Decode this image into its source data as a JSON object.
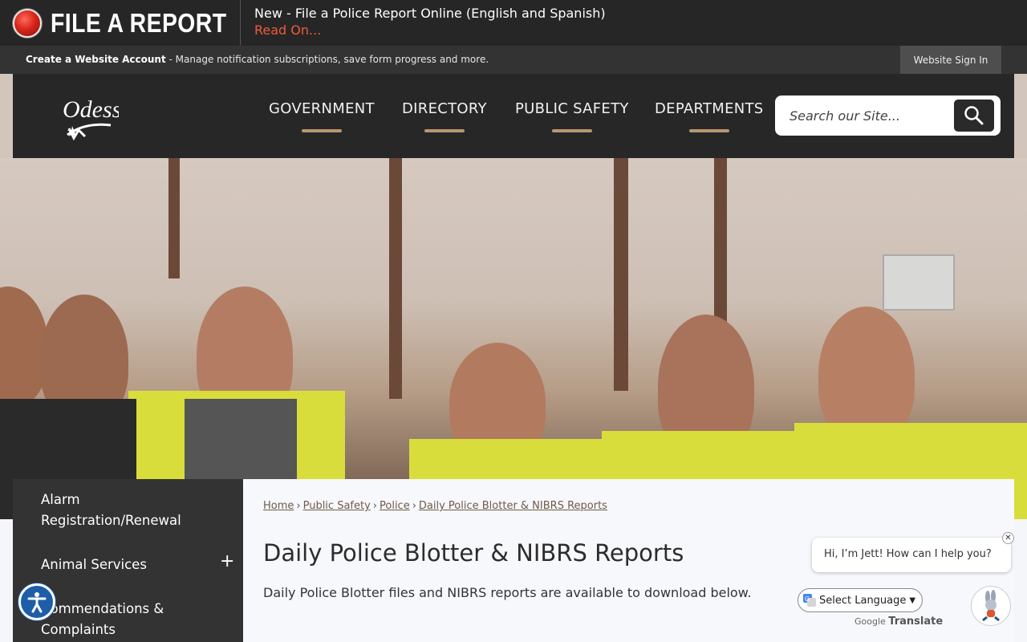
{
  "alert": {
    "label": "FILE A REPORT",
    "headline": "New - File a Police Report Online (English and Spanish)",
    "link": "Read On..."
  },
  "account": {
    "create_label": "Create a Website Account",
    "create_desc": " - Manage notification subscriptions, save form progress and more.",
    "signin_label": "Website Sign In"
  },
  "header": {
    "logo_text": "Odessa",
    "nav": [
      "GOVERNMENT",
      "DIRECTORY",
      "PUBLIC SAFETY",
      "DEPARTMENTS"
    ],
    "search_placeholder": "Search our Site..."
  },
  "sidebar": {
    "items": [
      {
        "label": "Alarm\nRegistration/Renewal"
      },
      {
        "label": "Animal Services"
      },
      {
        "label": "Commendations &\nComplaints"
      }
    ],
    "toggle": "+"
  },
  "breadcrumb": [
    "Home",
    "Public Safety",
    "Police",
    "Daily Police Blotter & NIBRS Reports"
  ],
  "page": {
    "title": "Daily Police Blotter & NIBRS Reports",
    "description": "Daily Police Blotter files and NIBRS reports are available to download below."
  },
  "chat": {
    "greeting": "Hi, I’m Jett! How can I help you?",
    "close": "✕"
  },
  "translate": {
    "select_label": "Select Language",
    "powered_prefix": "Google",
    "powered_word": "Translate"
  },
  "colors": {
    "accent_underline": "#b7976f",
    "alert_link": "#ef5a3a",
    "header_bg": "#272727"
  }
}
